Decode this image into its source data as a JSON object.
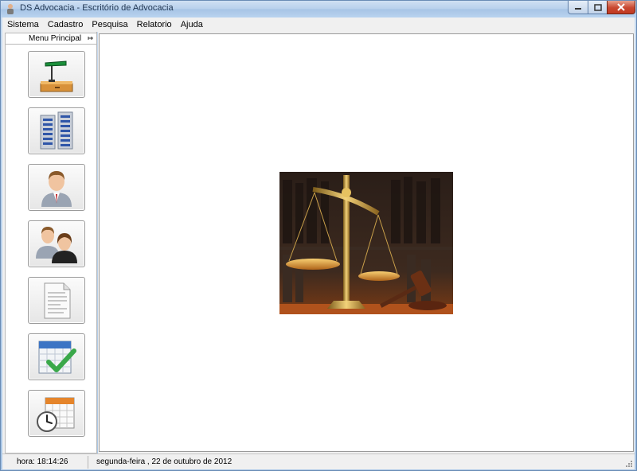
{
  "window": {
    "title": "DS Advocacia - Escritório de Advocacia"
  },
  "menu": {
    "items": [
      "Sistema",
      "Cadastro",
      "Pesquisa",
      "Relatorio",
      "Ajuda"
    ]
  },
  "sidebar": {
    "title": "Menu Principal",
    "tiles": [
      {
        "icon": "desk-lamp-icon"
      },
      {
        "icon": "office-buildings-icon"
      },
      {
        "icon": "person-icon"
      },
      {
        "icon": "people-icon"
      },
      {
        "icon": "document-icon"
      },
      {
        "icon": "calendar-check-icon"
      },
      {
        "icon": "calendar-clock-icon"
      }
    ]
  },
  "main": {
    "picture": "scales-of-justice-image"
  },
  "status": {
    "time": "hora:  18:14:26",
    "date": "segunda-feira ,  22 de outubro de 2012"
  },
  "colors": {
    "title_bar": "#b7d0ec",
    "close_button": "#c8472f",
    "panel_bg": "#f0f0f0"
  }
}
